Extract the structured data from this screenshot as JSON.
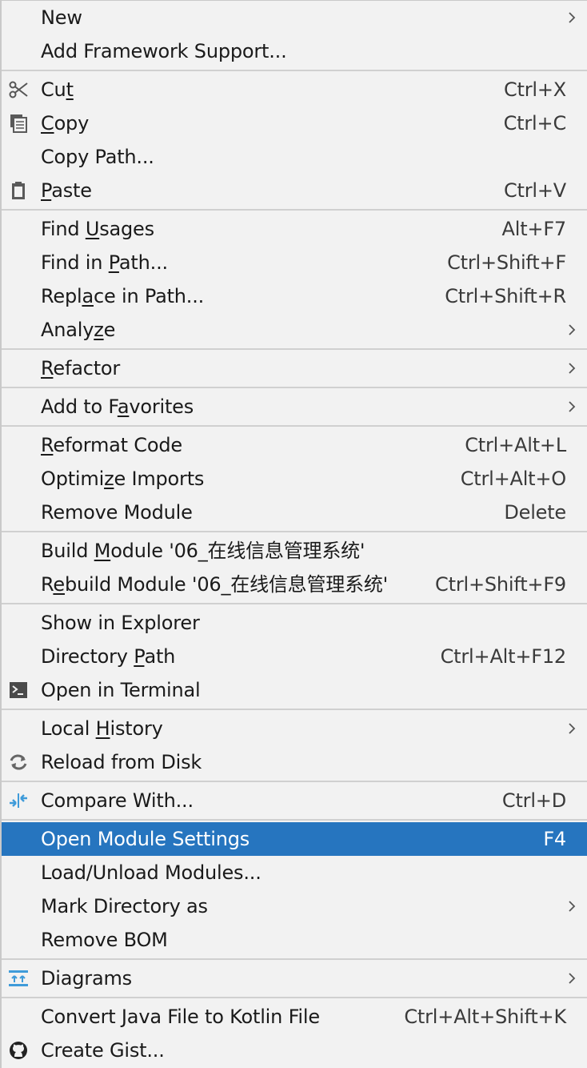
{
  "menu": {
    "new": {
      "label": "New"
    },
    "add_framework": {
      "label": "Add Framework Support..."
    },
    "cut": {
      "pre": "Cu",
      "u": "t",
      "post": "",
      "shortcut": "Ctrl+X"
    },
    "copy": {
      "pre": "",
      "u": "C",
      "post": "opy",
      "shortcut": "Ctrl+C"
    },
    "copy_path": {
      "label": "Copy Path..."
    },
    "paste": {
      "pre": "",
      "u": "P",
      "post": "aste",
      "shortcut": "Ctrl+V"
    },
    "find_usages": {
      "pre": "Find ",
      "u": "U",
      "post": "sages",
      "shortcut": "Alt+F7"
    },
    "find_in_path": {
      "pre": "Find in ",
      "u": "P",
      "post": "ath...",
      "shortcut": "Ctrl+Shift+F"
    },
    "replace_in_path": {
      "pre": "Repl",
      "u": "a",
      "post": "ce in Path...",
      "shortcut": "Ctrl+Shift+R"
    },
    "analyze": {
      "pre": "Analy",
      "u": "z",
      "post": "e"
    },
    "refactor": {
      "pre": "",
      "u": "R",
      "post": "efactor"
    },
    "add_to_favorites": {
      "pre": "Add to F",
      "u": "a",
      "post": "vorites"
    },
    "reformat_code": {
      "pre": "",
      "u": "R",
      "post": "eformat Code",
      "shortcut": "Ctrl+Alt+L"
    },
    "optimize_imports": {
      "pre": "Optimi",
      "u": "z",
      "post": "e Imports",
      "shortcut": "Ctrl+Alt+O"
    },
    "remove_module": {
      "label": "Remove Module",
      "shortcut": "Delete"
    },
    "build_module": {
      "pre": "Build ",
      "u": "M",
      "post": "odule '06_在线信息管理系统'"
    },
    "rebuild_module": {
      "pre": "R",
      "u": "e",
      "post": "build Module '06_在线信息管理系统'",
      "shortcut": "Ctrl+Shift+F9"
    },
    "show_in_explorer": {
      "label": "Show in Explorer"
    },
    "directory_path": {
      "pre": "Directory ",
      "u": "P",
      "post": "ath",
      "shortcut": "Ctrl+Alt+F12"
    },
    "open_in_terminal": {
      "label": "Open in Terminal"
    },
    "local_history": {
      "pre": "Local ",
      "u": "H",
      "post": "istory"
    },
    "reload_from_disk": {
      "label": "Reload from Disk"
    },
    "compare_with": {
      "label": "Compare With...",
      "shortcut": "Ctrl+D"
    },
    "open_module_settings": {
      "label": "Open Module Settings",
      "shortcut": "F4"
    },
    "load_unload_modules": {
      "label": "Load/Unload Modules..."
    },
    "mark_directory_as": {
      "label": "Mark Directory as"
    },
    "remove_bom": {
      "label": "Remove BOM"
    },
    "diagrams": {
      "label": "Diagrams"
    },
    "convert_java_to_kotlin": {
      "label": "Convert Java File to Kotlin File",
      "shortcut": "Ctrl+Alt+Shift+K"
    },
    "create_gist": {
      "label": "Create Gist..."
    }
  },
  "colors": {
    "background": "#f2f2f2",
    "selection": "#2675bf",
    "separator": "#d0d0d0",
    "compare_icon": "#3f9bd9"
  }
}
